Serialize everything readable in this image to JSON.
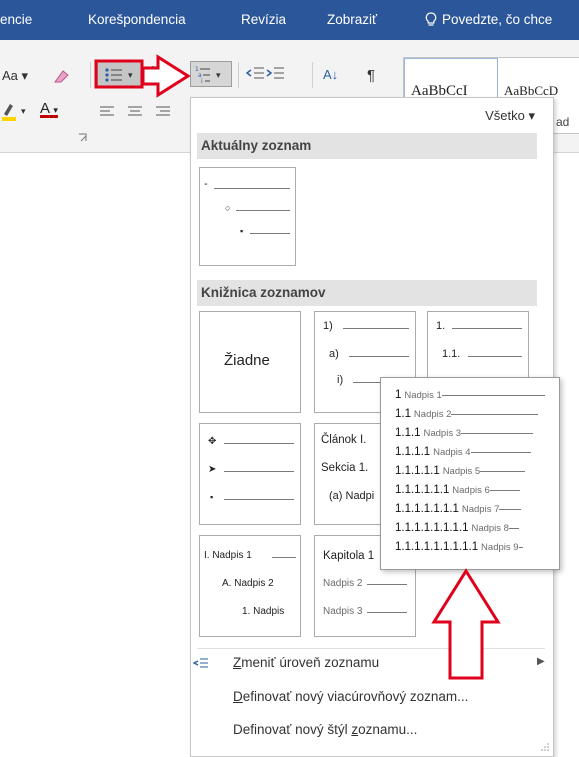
{
  "tabs": [
    "encie",
    "Korešpondencia",
    "Revízia",
    "Zobraziť"
  ],
  "tell_me": "Povedzte, čo chce",
  "ribbon": {
    "font_size_label": "Aa",
    "font_color_label": "A",
    "sort_label": "A↓",
    "pilcrow": "¶",
    "style1": "AaBbCcI",
    "style2": "AaBbCcD",
    "style2_sub": "ad"
  },
  "dropdown": {
    "filter_label": "Všetko",
    "current_header": "Aktuálny zoznam",
    "library_header": "Knižnica zoznamov",
    "none_label": "Žiadne",
    "thumb_1": [
      "1)",
      "a)",
      "i)"
    ],
    "thumb_2": [
      "1.",
      "1.1."
    ],
    "thumb_article": [
      "Článok I.",
      "Sekcia 1.",
      "(a) Nadpi"
    ],
    "thumb_heading": [
      "I. Nadpis 1",
      "A. Nadpis 2",
      "1. Nadpis"
    ],
    "thumb_chapter": [
      "Kapitola 1",
      "Nadpis 2",
      "Nadpis 3"
    ],
    "menu": [
      {
        "pre": "",
        "u": "Z",
        "post": "meniť úroveň zoznamu"
      },
      {
        "pre": "",
        "u": "D",
        "post": "efinovať nový viacúrovňový zoznam..."
      },
      {
        "pre": "Definovať nový štýl ",
        "u": "z",
        "post": "oznamu..."
      }
    ]
  },
  "popup_rows": [
    {
      "num": "1",
      "label": "Nadpis 1"
    },
    {
      "num": "1.1",
      "label": "Nadpis 2"
    },
    {
      "num": "1.1.1",
      "label": "Nadpis 3"
    },
    {
      "num": "1.1.1.1",
      "label": "Nadpis 4"
    },
    {
      "num": "1.1.1.1.1",
      "label": "Nadpis 5"
    },
    {
      "num": "1.1.1.1.1.1",
      "label": "Nadpis 6"
    },
    {
      "num": "1.1.1.1.1.1.1",
      "label": "Nadpis 7"
    },
    {
      "num": "1.1.1.1.1.1.1.1",
      "label": "Nadpis 8"
    },
    {
      "num": "1.1.1.1.1.1.1.1.1",
      "label": "Nadpis 9"
    }
  ],
  "colors": {
    "accent": "#2b579a",
    "arrow": "#e0001b",
    "font_red": "#c00000",
    "highlight_yellow": "#ffd400"
  }
}
